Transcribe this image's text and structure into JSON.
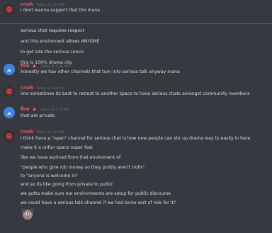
{
  "messages": [
    {
      "author": "rawb",
      "timestamp": "Today at 1:33 AM",
      "lines": [
        "i dont wanna support that tho mana"
      ]
    },
    {
      "author": "",
      "timestamp": "",
      "lines": [
        "serious chat requires respect",
        "and this enviroment allows ANYONE",
        "to get into the serious convo",
        "this is 100% drama city"
      ]
    },
    {
      "author": "fire",
      "timestamp": "Today at 1:34 AM",
      "lines": [
        "honestly we hav other channels that turn into serious talk anyway mana"
      ]
    },
    {
      "author": "rawb",
      "timestamp": "Today at 1:34 AM",
      "lines": [
        "imo sometimes its best to retreat to another space to have serious chats amongst community members"
      ]
    },
    {
      "author": "fire",
      "timestamp": "Today at 1:34 AM",
      "lines": [
        "that are private"
      ]
    },
    {
      "author": "rawb",
      "timestamp": "Today at 1:34 AM",
      "lines": [
        "i think have a \"open\" channel for serious chat is how new people can stir up drama way to easily in here",
        "make it a unfun space super fast",
        "like we have evolved from that enviroment of",
        "\"people who give rob money so they probly aren't trolls\"",
        "to \"anyone is welcome in\"",
        "and so its like going from private to public",
        "we gotta make sure our environments are setup for public discourse",
        "we could have a serious talk channel if we had some sort of role for it?"
      ]
    }
  ],
  "colors": {
    "background": "#36393f",
    "text": "#dcddde",
    "rawb_name": "#e04f5f",
    "fire_name": "#e86a4f",
    "timestamp": "#72767d"
  },
  "icons": {
    "fire_badge": "flame-badge-icon",
    "sticker": "creature-sticker-icon"
  }
}
